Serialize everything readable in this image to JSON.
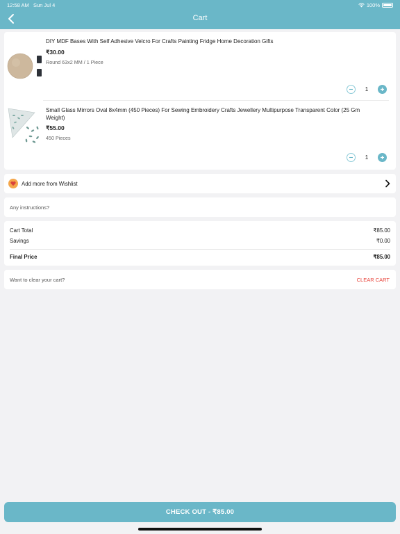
{
  "status_bar": {
    "time": "12:58 AM",
    "date": "Sun Jul 4",
    "battery": "100%"
  },
  "header": {
    "title": "Cart",
    "back_icon": "chevron-left-icon"
  },
  "cart": {
    "items": [
      {
        "name": "DIY MDF Bases With Self Adhesive Velcro For Crafts Painting Fridge Home Decoration Gifts",
        "price": "₹30.00",
        "variant": "Round 63x2 MM / 1 Piece",
        "quantity": "1"
      },
      {
        "name": "Small Glass Mirrors Oval 8x4mm (450 Pieces) For Sewing Embroidery Crafts Jewellery Multipurpose Transparent Color (25 Gm Weight)",
        "price": "₹55.00",
        "variant": "450 Pieces",
        "quantity": "1"
      }
    ]
  },
  "wishlist": {
    "label": "Add more from Wishlist",
    "icon": "heart-icon"
  },
  "instructions": {
    "placeholder": "Any instructions?"
  },
  "totals": {
    "cart_total_label": "Cart Total",
    "cart_total_value": "₹85.00",
    "savings_label": "Savings",
    "savings_value": "₹0.00",
    "final_price_label": "Final Price",
    "final_price_value": "₹85.00"
  },
  "clear_cart": {
    "prompt": "Want to clear your cart?",
    "button_label": "CLEAR CART"
  },
  "checkout": {
    "label": "CHECK OUT - ₹85.00"
  },
  "colors": {
    "accent": "#6ab7c8",
    "danger": "#e8453c",
    "background": "#f2f2f4"
  }
}
